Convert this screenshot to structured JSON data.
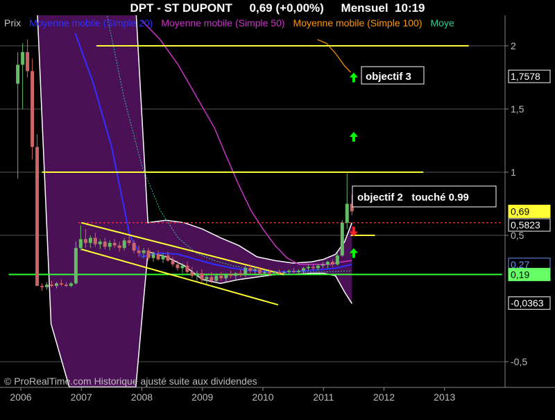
{
  "header": {
    "symbol": "DPT - ST DUPONT",
    "price": "0,69 (+0,00%)",
    "period": "Mensuel",
    "time": "10:19"
  },
  "legend": {
    "items": [
      {
        "label": "Prix",
        "color": "#c8c8c8"
      },
      {
        "label": "Moyenne mobile (Simple 20)",
        "color": "#3030ff"
      },
      {
        "label": "Moyenne mobile (Simple 50)",
        "color": "#cc33cc"
      },
      {
        "label": "Moyenne mobile (Simple 100)",
        "color": "#ff9900"
      },
      {
        "label": "Moye",
        "color": "#33cc99"
      }
    ]
  },
  "copyright": "© ProRealTime.com Historique ajusté suite aux dividendes",
  "annotations": {
    "objectif3": "objectif 3",
    "objectif2": "objectif 2   touché 0.99"
  },
  "price_tags": [
    {
      "label": "1,7578",
      "value": 1.7578,
      "bg": "#000000",
      "fg": "#ffffff",
      "border": "#ffffff"
    },
    {
      "label": "0,69",
      "value": 0.69,
      "bg": "#ffff33",
      "fg": "#000000",
      "border": "#ffff33"
    },
    {
      "label": "0,5823",
      "value": 0.5823,
      "bg": "#000000",
      "fg": "#ffffff",
      "border": "#ffffff"
    },
    {
      "label": "0,27",
      "value": 0.27,
      "bg": "#000000",
      "fg": "#6699ff",
      "border": "#6699ff"
    },
    {
      "label": "0,19",
      "value": 0.19,
      "bg": "#66ff66",
      "fg": "#000000",
      "border": "#66ff66"
    },
    {
      "label": "-0,0363",
      "value": -0.0363,
      "bg": "#000000",
      "fg": "#ffffff",
      "border": "#ffffff"
    }
  ],
  "colors": {
    "background": "#000000",
    "band_fill": "#4b1156",
    "band_edge": "#ffffff",
    "ma20": "#3030ff",
    "ma50": "#cc33cc",
    "ma100": "#ff9900",
    "ma_dotted": "#33cc99",
    "resistance": "#ffff33",
    "support_green": "#33ff33",
    "red_dotted": "#ff2222",
    "grid": "#555555",
    "up_candle": "#66bb66",
    "down_candle": "#cc6666",
    "arrow_up": "#00ff00",
    "arrow_down": "#ff2222"
  },
  "chart_data": {
    "type": "candlestick",
    "title": "DPT - ST DUPONT",
    "ylim": [
      -0.7,
      2.3
    ],
    "y_ticks": [
      {
        "value": 2,
        "label": "2"
      },
      {
        "value": 1.5,
        "label": "1,5"
      },
      {
        "value": 1,
        "label": "1"
      },
      {
        "value": 0.5,
        "label": "0,5"
      },
      {
        "value": -0.5,
        "label": "-0,5"
      }
    ],
    "x_ticks": [
      {
        "value": 2006.0,
        "label": "2006"
      },
      {
        "value": 2007.0,
        "label": "2007"
      },
      {
        "value": 2008.0,
        "label": "2008"
      },
      {
        "value": 2009.0,
        "label": "2009"
      },
      {
        "value": 2010.0,
        "label": "2010"
      },
      {
        "value": 2011.0,
        "label": "2011"
      },
      {
        "value": 2012.0,
        "label": "2012"
      },
      {
        "value": 2013.0,
        "label": "2013"
      }
    ],
    "candles": [
      {
        "t": 2005.95,
        "o": 1.7,
        "h": 1.95,
        "l": 0.95,
        "c": 1.85
      },
      {
        "t": 2006.03,
        "o": 1.85,
        "h": 2.02,
        "l": 1.5,
        "c": 1.95
      },
      {
        "t": 2006.11,
        "o": 1.95,
        "h": 2.05,
        "l": 1.75,
        "c": 1.8
      },
      {
        "t": 2006.19,
        "o": 1.8,
        "h": 1.9,
        "l": 1.1,
        "c": 1.2
      },
      {
        "t": 2006.27,
        "o": 1.2,
        "h": 1.3,
        "l": 0.2,
        "c": 0.1
      },
      {
        "t": 2006.35,
        "o": 0.1,
        "h": 0.12,
        "l": 0.06,
        "c": 0.09
      },
      {
        "t": 2006.43,
        "o": 0.09,
        "h": 0.13,
        "l": 0.07,
        "c": 0.11
      },
      {
        "t": 2006.51,
        "o": 0.11,
        "h": 0.14,
        "l": 0.09,
        "c": 0.1
      },
      {
        "t": 2006.59,
        "o": 0.1,
        "h": 0.13,
        "l": 0.08,
        "c": 0.12
      },
      {
        "t": 2006.67,
        "o": 0.12,
        "h": 0.15,
        "l": 0.1,
        "c": 0.11
      },
      {
        "t": 2006.75,
        "o": 0.11,
        "h": 0.13,
        "l": 0.09,
        "c": 0.1
      },
      {
        "t": 2006.83,
        "o": 0.1,
        "h": 0.13,
        "l": 0.09,
        "c": 0.12
      },
      {
        "t": 2006.91,
        "o": 0.12,
        "h": 0.45,
        "l": 0.11,
        "c": 0.4
      },
      {
        "t": 2006.99,
        "o": 0.4,
        "h": 0.58,
        "l": 0.38,
        "c": 0.47
      },
      {
        "t": 2007.07,
        "o": 0.47,
        "h": 0.55,
        "l": 0.4,
        "c": 0.44
      },
      {
        "t": 2007.15,
        "o": 0.44,
        "h": 0.5,
        "l": 0.4,
        "c": 0.48
      },
      {
        "t": 2007.23,
        "o": 0.48,
        "h": 0.52,
        "l": 0.41,
        "c": 0.43
      },
      {
        "t": 2007.31,
        "o": 0.43,
        "h": 0.47,
        "l": 0.39,
        "c": 0.45
      },
      {
        "t": 2007.39,
        "o": 0.45,
        "h": 0.48,
        "l": 0.39,
        "c": 0.41
      },
      {
        "t": 2007.47,
        "o": 0.41,
        "h": 0.46,
        "l": 0.38,
        "c": 0.44
      },
      {
        "t": 2007.55,
        "o": 0.44,
        "h": 0.47,
        "l": 0.4,
        "c": 0.42
      },
      {
        "t": 2007.63,
        "o": 0.42,
        "h": 0.45,
        "l": 0.37,
        "c": 0.4
      },
      {
        "t": 2007.71,
        "o": 0.4,
        "h": 0.48,
        "l": 0.38,
        "c": 0.46
      },
      {
        "t": 2007.79,
        "o": 0.46,
        "h": 0.5,
        "l": 0.42,
        "c": 0.44
      },
      {
        "t": 2007.87,
        "o": 0.44,
        "h": 0.46,
        "l": 0.36,
        "c": 0.38
      },
      {
        "t": 2007.95,
        "o": 0.38,
        "h": 0.42,
        "l": 0.33,
        "c": 0.36
      },
      {
        "t": 2008.03,
        "o": 0.36,
        "h": 0.4,
        "l": 0.32,
        "c": 0.38
      },
      {
        "t": 2008.11,
        "o": 0.38,
        "h": 0.4,
        "l": 0.3,
        "c": 0.32
      },
      {
        "t": 2008.19,
        "o": 0.32,
        "h": 0.37,
        "l": 0.29,
        "c": 0.35
      },
      {
        "t": 2008.27,
        "o": 0.35,
        "h": 0.38,
        "l": 0.3,
        "c": 0.31
      },
      {
        "t": 2008.35,
        "o": 0.31,
        "h": 0.36,
        "l": 0.28,
        "c": 0.34
      },
      {
        "t": 2008.43,
        "o": 0.34,
        "h": 0.37,
        "l": 0.29,
        "c": 0.3
      },
      {
        "t": 2008.51,
        "o": 0.3,
        "h": 0.33,
        "l": 0.25,
        "c": 0.27
      },
      {
        "t": 2008.59,
        "o": 0.27,
        "h": 0.3,
        "l": 0.22,
        "c": 0.24
      },
      {
        "t": 2008.67,
        "o": 0.24,
        "h": 0.28,
        "l": 0.2,
        "c": 0.26
      },
      {
        "t": 2008.75,
        "o": 0.26,
        "h": 0.29,
        "l": 0.19,
        "c": 0.21
      },
      {
        "t": 2008.83,
        "o": 0.21,
        "h": 0.25,
        "l": 0.16,
        "c": 0.18
      },
      {
        "t": 2008.91,
        "o": 0.18,
        "h": 0.22,
        "l": 0.14,
        "c": 0.2
      },
      {
        "t": 2008.99,
        "o": 0.2,
        "h": 0.23,
        "l": 0.13,
        "c": 0.15
      },
      {
        "t": 2009.07,
        "o": 0.15,
        "h": 0.19,
        "l": 0.11,
        "c": 0.17
      },
      {
        "t": 2009.15,
        "o": 0.17,
        "h": 0.21,
        "l": 0.12,
        "c": 0.14
      },
      {
        "t": 2009.23,
        "o": 0.14,
        "h": 0.2,
        "l": 0.12,
        "c": 0.18
      },
      {
        "t": 2009.31,
        "o": 0.18,
        "h": 0.21,
        "l": 0.14,
        "c": 0.16
      },
      {
        "t": 2009.39,
        "o": 0.16,
        "h": 0.2,
        "l": 0.13,
        "c": 0.19
      },
      {
        "t": 2009.47,
        "o": 0.19,
        "h": 0.22,
        "l": 0.16,
        "c": 0.18
      },
      {
        "t": 2009.55,
        "o": 0.18,
        "h": 0.21,
        "l": 0.15,
        "c": 0.2
      },
      {
        "t": 2009.63,
        "o": 0.2,
        "h": 0.23,
        "l": 0.17,
        "c": 0.19
      },
      {
        "t": 2009.71,
        "o": 0.19,
        "h": 0.26,
        "l": 0.17,
        "c": 0.24
      },
      {
        "t": 2009.79,
        "o": 0.24,
        "h": 0.27,
        "l": 0.2,
        "c": 0.22
      },
      {
        "t": 2009.87,
        "o": 0.22,
        "h": 0.25,
        "l": 0.19,
        "c": 0.23
      },
      {
        "t": 2009.95,
        "o": 0.23,
        "h": 0.25,
        "l": 0.19,
        "c": 0.2
      },
      {
        "t": 2010.03,
        "o": 0.2,
        "h": 0.23,
        "l": 0.18,
        "c": 0.21
      },
      {
        "t": 2010.11,
        "o": 0.21,
        "h": 0.23,
        "l": 0.18,
        "c": 0.2
      },
      {
        "t": 2010.19,
        "o": 0.2,
        "h": 0.22,
        "l": 0.18,
        "c": 0.21
      },
      {
        "t": 2010.27,
        "o": 0.21,
        "h": 0.23,
        "l": 0.19,
        "c": 0.2
      },
      {
        "t": 2010.35,
        "o": 0.2,
        "h": 0.22,
        "l": 0.18,
        "c": 0.21
      },
      {
        "t": 2010.43,
        "o": 0.21,
        "h": 0.23,
        "l": 0.19,
        "c": 0.22
      },
      {
        "t": 2010.51,
        "o": 0.22,
        "h": 0.24,
        "l": 0.2,
        "c": 0.21
      },
      {
        "t": 2010.59,
        "o": 0.21,
        "h": 0.23,
        "l": 0.19,
        "c": 0.22
      },
      {
        "t": 2010.67,
        "o": 0.22,
        "h": 0.25,
        "l": 0.2,
        "c": 0.24
      },
      {
        "t": 2010.75,
        "o": 0.24,
        "h": 0.27,
        "l": 0.22,
        "c": 0.25
      },
      {
        "t": 2010.83,
        "o": 0.25,
        "h": 0.27,
        "l": 0.22,
        "c": 0.24
      },
      {
        "t": 2010.91,
        "o": 0.24,
        "h": 0.27,
        "l": 0.22,
        "c": 0.26
      },
      {
        "t": 2010.99,
        "o": 0.26,
        "h": 0.29,
        "l": 0.24,
        "c": 0.27
      },
      {
        "t": 2011.07,
        "o": 0.27,
        "h": 0.3,
        "l": 0.24,
        "c": 0.29
      },
      {
        "t": 2011.15,
        "o": 0.29,
        "h": 0.31,
        "l": 0.25,
        "c": 0.27
      },
      {
        "t": 2011.23,
        "o": 0.27,
        "h": 0.36,
        "l": 0.26,
        "c": 0.34
      },
      {
        "t": 2011.31,
        "o": 0.34,
        "h": 0.62,
        "l": 0.33,
        "c": 0.6
      },
      {
        "t": 2011.39,
        "o": 0.6,
        "h": 0.99,
        "l": 0.55,
        "c": 0.75
      },
      {
        "t": 2011.47,
        "o": 0.75,
        "h": 0.82,
        "l": 0.66,
        "c": 0.69
      }
    ],
    "bollinger": {
      "t": [
        2006.27,
        2006.5,
        2006.8,
        2007.0,
        2007.3,
        2007.6,
        2007.9,
        2008.1,
        2008.4,
        2008.7,
        2009.0,
        2009.3,
        2009.6,
        2009.9,
        2010.2,
        2010.5,
        2010.8,
        2011.0,
        2011.2,
        2011.35,
        2011.47
      ],
      "upper": [
        2.3,
        2.3,
        2.3,
        2.3,
        2.3,
        2.3,
        2.3,
        0.6,
        0.62,
        0.6,
        0.55,
        0.48,
        0.42,
        0.33,
        0.3,
        0.28,
        0.29,
        0.31,
        0.35,
        0.45,
        0.6
      ],
      "lower": [
        2.3,
        -0.2,
        -0.7,
        -0.7,
        -0.7,
        -0.7,
        -0.7,
        0.37,
        0.33,
        0.26,
        0.15,
        0.12,
        0.15,
        0.17,
        0.19,
        0.19,
        0.2,
        0.2,
        0.18,
        0.05,
        -0.04
      ]
    },
    "ma20": {
      "t": [
        2006.9,
        2007.2,
        2007.5,
        2007.8,
        2008.0,
        2008.3,
        2008.6,
        2008.9,
        2009.2,
        2009.5,
        2009.8,
        2010.1,
        2010.4,
        2010.7,
        2011.0,
        2011.2,
        2011.47
      ],
      "y": [
        2.1,
        1.7,
        1.2,
        0.5,
        0.33,
        0.36,
        0.35,
        0.31,
        0.27,
        0.24,
        0.22,
        0.21,
        0.21,
        0.22,
        0.23,
        0.24,
        0.27
      ]
    },
    "ma50": {
      "t": [
        2008.0,
        2008.3,
        2008.6,
        2008.9,
        2009.2,
        2009.4,
        2009.6,
        2009.8,
        2010.0,
        2010.2,
        2010.4,
        2010.6,
        2010.9,
        2011.1,
        2011.3,
        2011.47
      ],
      "y": [
        2.2,
        2.05,
        1.85,
        1.6,
        1.35,
        1.12,
        0.9,
        0.7,
        0.55,
        0.42,
        0.32,
        0.27,
        0.27,
        0.27,
        0.29,
        0.3
      ]
    },
    "ma100": {
      "t": [
        2010.9,
        2011.05,
        2011.2,
        2011.35,
        2011.45
      ],
      "y": [
        2.05,
        2.02,
        1.94,
        1.84,
        1.79
      ]
    },
    "ma_dotted": {
      "t": [
        2007.4,
        2007.7,
        2008.0,
        2008.3,
        2008.6,
        2008.9,
        2009.2,
        2009.5,
        2010.0,
        2010.5,
        2011.0,
        2011.47
      ],
      "y": [
        2.3,
        1.6,
        1.05,
        0.7,
        0.48,
        0.36,
        0.3,
        0.26,
        0.22,
        0.21,
        0.21,
        0.22
      ]
    },
    "lines": [
      {
        "name": "resistance-2",
        "type": "horizontal",
        "y": 2.0,
        "t0": 2007.25,
        "t1": 2013.4,
        "color": "#ffff33",
        "dash": ""
      },
      {
        "name": "resistance-1",
        "type": "horizontal",
        "y": 1.0,
        "t0": 2006.35,
        "t1": 2012.65,
        "color": "#ffff33",
        "dash": ""
      },
      {
        "name": "target-0-5",
        "type": "horizontal",
        "y": 0.5,
        "t0": 2011.45,
        "t1": 2011.85,
        "color": "#ffff33",
        "dash": ""
      },
      {
        "name": "red-dotted",
        "type": "horizontal",
        "y": 0.6,
        "t0": 2006.95,
        "t1": 2013.95,
        "color": "#ff2222",
        "dash": "3,3"
      },
      {
        "name": "green-support",
        "type": "horizontal",
        "y": 0.19,
        "t0": 2005.8,
        "t1": 2013.95,
        "color": "#33ff33",
        "dash": ""
      },
      {
        "name": "channel-upper",
        "type": "segment",
        "t0": 2007.0,
        "y0": 0.6,
        "t1": 2010.35,
        "y1": 0.19,
        "color": "#ffff33",
        "dash": ""
      },
      {
        "name": "channel-lower",
        "type": "segment",
        "t0": 2007.0,
        "y0": 0.39,
        "t1": 2010.25,
        "y1": -0.05,
        "color": "#ffff33",
        "dash": ""
      }
    ],
    "arrows": [
      {
        "name": "arrow-up-1",
        "t": 2011.5,
        "y": 1.75,
        "dir": "up"
      },
      {
        "name": "arrow-up-2",
        "t": 2011.5,
        "y": 1.28,
        "dir": "up"
      },
      {
        "name": "arrow-up-3",
        "t": 2011.5,
        "y": 0.36,
        "dir": "up"
      },
      {
        "name": "arrow-down-1",
        "t": 2011.5,
        "y": 0.53,
        "dir": "down"
      }
    ]
  }
}
